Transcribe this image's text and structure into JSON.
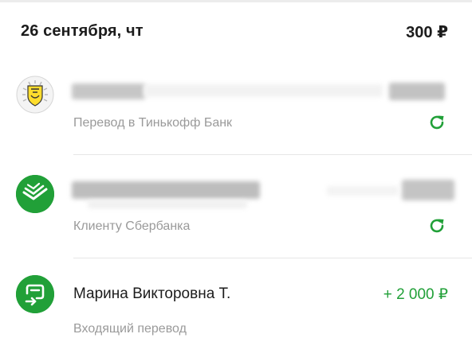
{
  "day": {
    "date": "26 сентября, чт",
    "total": "300 ₽"
  },
  "transactions": [
    {
      "title": "",
      "subtitle": "Перевод в Тинькофф Банк",
      "amount": "",
      "bank_icon": "tinkoff-logo-icon",
      "action_icon": "repeat-icon"
    },
    {
      "title": "",
      "subtitle": "Клиенту Сбербанка",
      "amount": "",
      "bank_icon": "sberbank-logo-icon",
      "action_icon": "repeat-icon"
    },
    {
      "title": "Марина Викторовна Т.",
      "subtitle": "Входящий перевод",
      "amount": "+ 2 000 ₽",
      "bank_icon": "incoming-transfer-icon"
    }
  ],
  "colors": {
    "accent_green": "#21a038",
    "subtitle_gray": "#9a9a9a",
    "tinkoff_yellow": "#ffdd2d"
  }
}
